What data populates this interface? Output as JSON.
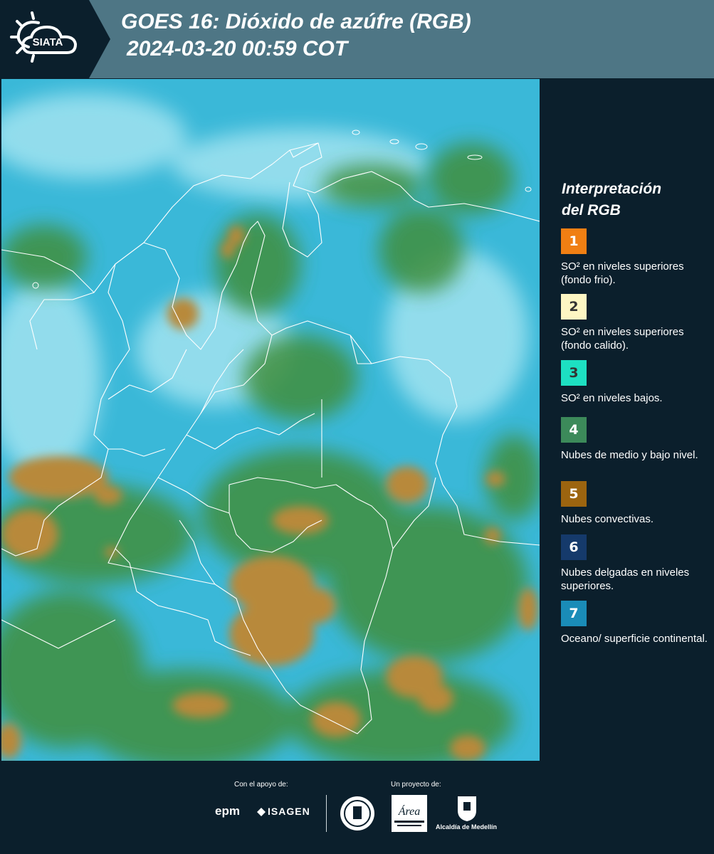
{
  "header": {
    "logo_text": "SIATA",
    "title_line1": "GOES 16: Dióxido de azúfre (RGB)",
    "title_line2": "2024-03-20 00:59 COT"
  },
  "map": {
    "description_icon": "satellite-composite-map",
    "colors": {
      "ocean_surface": "#3ab8d8",
      "mid_low_clouds": "#3e9a3e",
      "convective_clouds": "#b8893a",
      "borders": "#ffffff"
    }
  },
  "legend": {
    "title_line1": "Interpretación",
    "title_line2": "del RGB",
    "items": [
      {
        "number": "1",
        "color": "#f07f13",
        "text_color": "#ffffff",
        "label": "SO² en niveles superiores (fondo frio)."
      },
      {
        "number": "2",
        "color": "#fdf6c3",
        "text_color": "#333333",
        "label": "SO² en niveles superiores (fondo calido)."
      },
      {
        "number": "3",
        "color": "#1de0c2",
        "text_color": "#333333",
        "label": "SO² en niveles bajos."
      },
      {
        "number": "4",
        "color": "#3c8a5a",
        "text_color": "#ffffff",
        "label": "Nubes de medio y bajo nivel."
      },
      {
        "number": "5",
        "color": "#9c640f",
        "text_color": "#ffffff",
        "label": "Nubes convectivas."
      },
      {
        "number": "6",
        "color": "#153a6b",
        "text_color": "#ffffff",
        "label": "Nubes delgadas en niveles superiores."
      },
      {
        "number": "7",
        "color": "#1a8cb8",
        "text_color": "#ffffff",
        "label": "Oceano/ superficie continental."
      }
    ]
  },
  "footer": {
    "support_label": "Con el apoyo de:",
    "project_label": "Un proyecto de:",
    "epm": "epm",
    "isagen": "ISAGEN",
    "area_metro": "Área Metropolitana Valle de Aburrá",
    "alcaldia": "Alcaldía de Medellín"
  }
}
